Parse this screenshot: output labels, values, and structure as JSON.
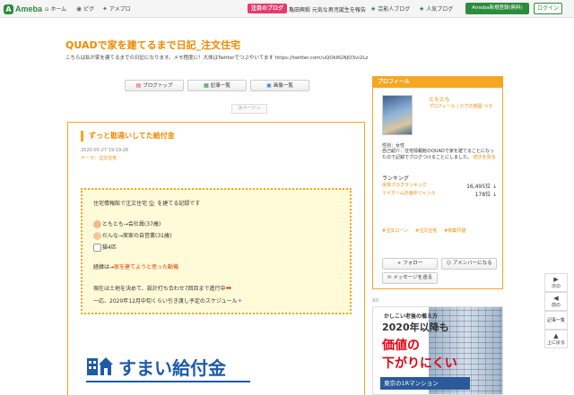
{
  "topbar": {
    "logo": "Ameba",
    "nav": [
      {
        "icon": "home-icon",
        "glyph": "⌂",
        "label": "ホーム"
      },
      {
        "icon": "pigg-icon",
        "glyph": "◉",
        "label": "ピグ"
      },
      {
        "icon": "app-icon",
        "glyph": "✦",
        "label": "アメブロ"
      }
    ],
    "featured_label": "注目のブログ",
    "featured_text": "亀田興毅 元気な男児誕生を報告",
    "links": [
      {
        "icon": "star-icon",
        "glyph": "★",
        "label": "芸能人ブログ"
      },
      {
        "icon": "star-icon",
        "glyph": "★",
        "label": "人気ブログ"
      }
    ],
    "signup": "Ameba新規登録(無料)",
    "login": "ログイン"
  },
  "blog": {
    "title": "QUADで家を建てるまで日記_注文住宅",
    "description": "こちらは私が家を建てるまでの日記になります。メモ程度に！大体はTwitterでつぶやいてます  https://twitter.com/uQOk8GNJO3vi2Lz"
  },
  "navbuttons": [
    {
      "icon": "blog-icon",
      "glyph": "▤",
      "label": "ブログトップ"
    },
    {
      "icon": "list-icon",
      "glyph": "▦",
      "label": "記事一覧"
    },
    {
      "icon": "image-icon",
      "glyph": "▣",
      "label": "画像一覧"
    }
  ],
  "next_page": "次ページ ▷",
  "article": {
    "title": "ずっと勘違いしてた給付金",
    "date": "2020-05-27 19:19:28",
    "theme": "テーマ：注文住宅",
    "box": {
      "intro": "住宅情報館で注文住宅 🏠 を建てる記録です",
      "members": [
        {
          "icon": "man-face-icon",
          "text": "ともとも→会社員(37歳)"
        },
        {
          "icon": "woman-face-icon",
          "text": "だんな→実家の自営業(31歳)"
        },
        {
          "icon": "cat-icon",
          "text": "猫4匹"
        }
      ],
      "reason_prefix": "経緯は→",
      "reason_link": "家を建てようと思った動機",
      "status": "現在は土地を決めて、設計打ち合わせ7回目まで進行中",
      "schedule": "一応、2020年12月中旬くらい引き渡し予定のスケジュール"
    },
    "banner": "すまい給付金"
  },
  "profile": {
    "header": "プロフィール",
    "name": "ともとも",
    "sub": "プロフィール | ピグの部屋 ペタ",
    "gender": "性別：女性",
    "intro": "自己紹介：住宅情報館のQUADで家を建てることになったので記録でブログつけることにしました。",
    "more": "続きを見る",
    "ranking_header": "ランキング",
    "rankings": [
      {
        "label": "全体ブログランキング",
        "value": "16,495位 ↓"
      },
      {
        "label": "マイホーム計画中ジャンル",
        "value": "178位 ↓"
      }
    ],
    "tags": [
      "#注文ローン",
      "#注文住宅",
      "#新築戸建"
    ],
    "buttons": {
      "follow": "フォロー",
      "amember": "アメンバーになる",
      "message": "メッセージを送る"
    }
  },
  "ad": {
    "label": "AD",
    "line1": "かしこい老後の備え方",
    "line2": "2020年以降も",
    "line3": "価値の",
    "line4": "下がりにくい",
    "line5": "東京の1Rマンション"
  },
  "float_nav": [
    {
      "icon": "next-article-icon",
      "glyph": "▶",
      "label": "次の"
    },
    {
      "icon": "prev-article-icon",
      "glyph": "◀",
      "label": "前の"
    },
    {
      "icon": "list-icon",
      "glyph": "",
      "label": "記事一覧"
    },
    {
      "icon": "up-icon",
      "glyph": "▲",
      "label": "上に戻る"
    }
  ]
}
